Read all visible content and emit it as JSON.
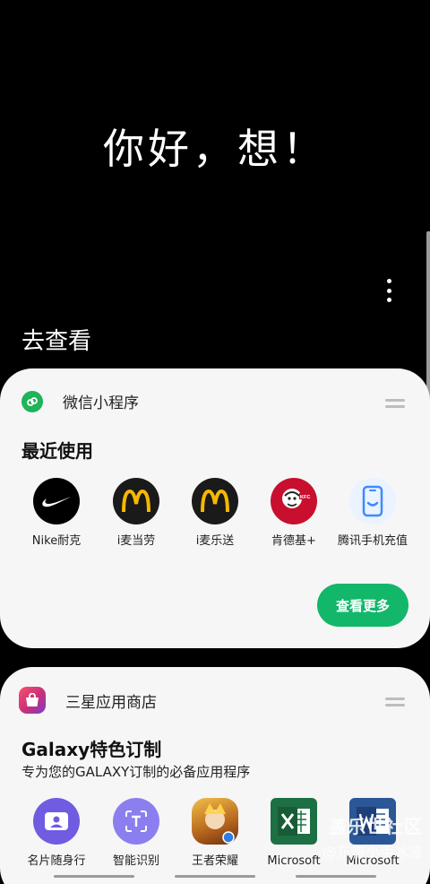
{
  "greeting": "你好，想！",
  "section_heading": "去查看",
  "wechat_card": {
    "header_label": "微信小程序",
    "title": "最近使用",
    "apps": [
      {
        "name": "Nike耐克",
        "icon": "nike-icon",
        "bg": "#000000"
      },
      {
        "name": "i麦当劳",
        "icon": "mcdonalds-icon",
        "bg": "#1a1a1a"
      },
      {
        "name": "i麦乐送",
        "icon": "mcdelivery-icon",
        "bg": "#1a1a1a"
      },
      {
        "name": "肯德基+",
        "icon": "kfc-icon",
        "bg": "#c8102e"
      },
      {
        "name": "腾讯手机充值",
        "icon": "phone-recharge-icon",
        "bg": "#eaf3ff"
      }
    ],
    "more_button": "查看更多"
  },
  "store_card": {
    "header_label": "三星应用商店",
    "title": "Galaxy特色订制",
    "subtitle": "专为您的GALAXY订制的必备应用程序",
    "apps": [
      {
        "name": "名片随身行",
        "icon": "business-card-icon",
        "bg": "#6f5ce0"
      },
      {
        "name": "智能识别",
        "icon": "text-recognition-icon",
        "bg": "#8b7ff0"
      },
      {
        "name": "王者荣耀",
        "icon": "honor-of-kings-icon",
        "bg": "#d89a2c"
      },
      {
        "name": "Microsoft",
        "icon": "excel-icon",
        "bg": "#1d7044"
      },
      {
        "name": "Microsoft",
        "icon": "word-icon",
        "bg": "#2b5797"
      }
    ]
  },
  "watermark": {
    "line1": "盖乐世社区",
    "line2": "@东得小手冰凉"
  },
  "colors": {
    "accent_green": "#12b76a",
    "card_bg": "#f6f6f6",
    "background": "#000000"
  }
}
